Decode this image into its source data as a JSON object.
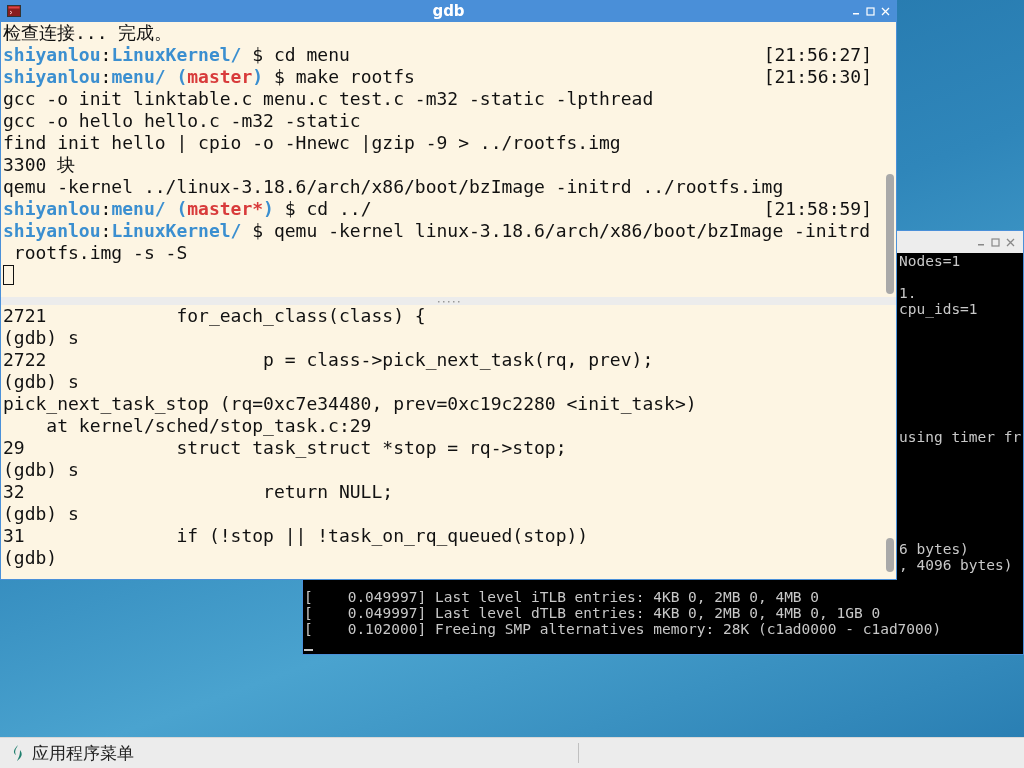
{
  "gdb_window": {
    "title": "gdb",
    "top_pane": {
      "lines": [
        {
          "kind": "text",
          "text": "检查连接... 完成。"
        },
        {
          "kind": "prompt",
          "segments": [
            {
              "text": "shiyanlou",
              "kind": "user"
            },
            {
              "text": ":",
              "kind": "plain"
            },
            {
              "text": "LinuxKernel/",
              "kind": "path"
            },
            {
              "text": " $ cd menu",
              "kind": "plain"
            }
          ],
          "time": "[21:56:27]"
        },
        {
          "kind": "prompt",
          "segments": [
            {
              "text": "shiyanlou",
              "kind": "user"
            },
            {
              "text": ":",
              "kind": "plain"
            },
            {
              "text": "menu/ (",
              "kind": "path"
            },
            {
              "text": "master",
              "kind": "branch"
            },
            {
              "text": ")",
              "kind": "path"
            },
            {
              "text": " $ make rootfs",
              "kind": "plain"
            }
          ],
          "time": "[21:56:30]"
        },
        {
          "kind": "text",
          "text": "gcc -o init linktable.c menu.c test.c -m32 -static -lpthread"
        },
        {
          "kind": "text",
          "text": "gcc -o hello hello.c -m32 -static"
        },
        {
          "kind": "text",
          "text": "find init hello | cpio -o -Hnewc |gzip -9 > ../rootfs.img"
        },
        {
          "kind": "text",
          "text": "3300 块"
        },
        {
          "kind": "text",
          "text": "qemu -kernel ../linux-3.18.6/arch/x86/boot/bzImage -initrd ../rootfs.img"
        },
        {
          "kind": "prompt",
          "segments": [
            {
              "text": "shiyanlou",
              "kind": "user"
            },
            {
              "text": ":",
              "kind": "plain"
            },
            {
              "text": "menu/ (",
              "kind": "path"
            },
            {
              "text": "master*",
              "kind": "branch"
            },
            {
              "text": ")",
              "kind": "path"
            },
            {
              "text": " $ cd ../",
              "kind": "plain"
            }
          ],
          "time": "[21:58:59]"
        },
        {
          "kind": "prompt",
          "segments": [
            {
              "text": "shiyanlou",
              "kind": "user"
            },
            {
              "text": ":",
              "kind": "plain"
            },
            {
              "text": "LinuxKernel/",
              "kind": "path"
            },
            {
              "text": " $ qemu -kernel linux-3.18.6/arch/x86/boot/bzImage -initrd",
              "kind": "plain"
            }
          ]
        },
        {
          "kind": "text",
          "text": " rootfs.img -s -S"
        },
        {
          "kind": "cursor"
        }
      ]
    },
    "bottom_pane": {
      "lines": [
        {
          "kind": "text",
          "text": "2721            for_each_class(class) {"
        },
        {
          "kind": "text",
          "text": "(gdb) s"
        },
        {
          "kind": "text",
          "text": "2722                    p = class->pick_next_task(rq, prev);"
        },
        {
          "kind": "text",
          "text": "(gdb) s"
        },
        {
          "kind": "text",
          "text": "pick_next_task_stop (rq=0xc7e34480, prev=0xc19c2280 <init_task>)"
        },
        {
          "kind": "text",
          "text": "    at kernel/sched/stop_task.c:29"
        },
        {
          "kind": "text",
          "text": "29              struct task_struct *stop = rq->stop;"
        },
        {
          "kind": "text",
          "text": "(gdb) s"
        },
        {
          "kind": "text",
          "text": "32                      return NULL;"
        },
        {
          "kind": "text",
          "text": "(gdb) s"
        },
        {
          "kind": "text",
          "text": "31              if (!stop || !task_on_rq_queued(stop))"
        },
        {
          "kind": "text",
          "text": "(gdb)"
        }
      ]
    }
  },
  "qemu_window": {
    "lines": [
      {
        "kind": "behind",
        "text": "Nodes=1"
      },
      {
        "kind": "blank"
      },
      {
        "kind": "behind",
        "text": "1."
      },
      {
        "kind": "behind",
        "text": "cpu_ids=1"
      },
      {
        "kind": "blank"
      },
      {
        "kind": "blank"
      },
      {
        "kind": "blank"
      },
      {
        "kind": "blank"
      },
      {
        "kind": "blank"
      },
      {
        "kind": "blank"
      },
      {
        "kind": "blank"
      },
      {
        "kind": "behind",
        "text": "using timer fr"
      },
      {
        "kind": "blank"
      },
      {
        "kind": "blank"
      },
      {
        "kind": "blank"
      },
      {
        "kind": "blank"
      },
      {
        "kind": "blank"
      },
      {
        "kind": "blank"
      },
      {
        "kind": "behind",
        "text": "6 bytes)"
      },
      {
        "kind": "behind",
        "text": ", 4096 bytes)"
      },
      {
        "kind": "blank"
      },
      {
        "kind": "full",
        "text": "[    0.049997] Last level iTLB entries: 4KB 0, 2MB 0, 4MB 0"
      },
      {
        "kind": "full",
        "text": "[    0.049997] Last level dTLB entries: 4KB 0, 2MB 0, 4MB 0, 1GB 0"
      },
      {
        "kind": "full",
        "text": "[    0.102000] Freeing SMP alternatives memory: 28K (c1ad0000 - c1ad7000)"
      },
      {
        "kind": "cursor"
      }
    ]
  },
  "taskbar": {
    "menu_label": "应用程序菜单"
  }
}
